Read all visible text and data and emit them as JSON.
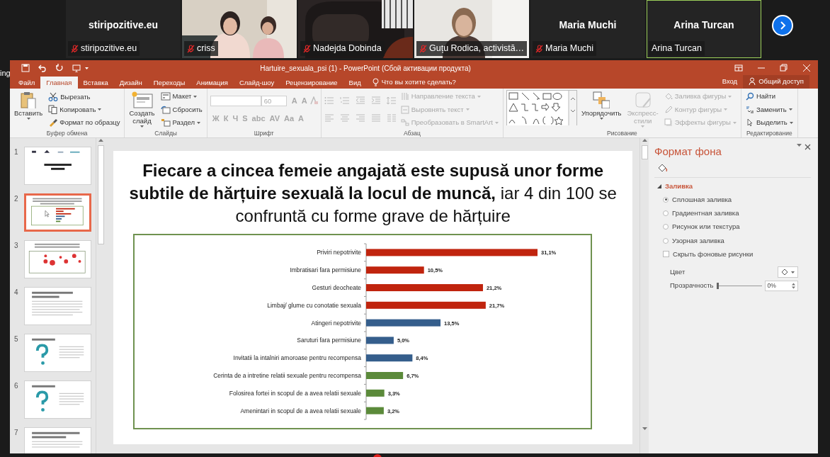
{
  "participants": [
    {
      "kind": "name",
      "name": "stiripozitive.eu",
      "label": "stiripozitive.eu",
      "muted": true,
      "speaking": false
    },
    {
      "kind": "video",
      "label": "criss",
      "muted": true,
      "speaking": false
    },
    {
      "kind": "video",
      "label": "Nadejda Dobinda",
      "muted": true,
      "speaking": false
    },
    {
      "kind": "video",
      "label": "Guțu Rodica, activistă…",
      "muted": true,
      "speaking": false
    },
    {
      "kind": "name",
      "name": "Maria Muchi",
      "label": "Maria Muchi",
      "muted": true,
      "speaking": false
    },
    {
      "kind": "name",
      "name": "Arina Turcan",
      "label": "Arina Turcan",
      "muted": false,
      "speaking": true
    }
  ],
  "behind_window_text": "ing",
  "window": {
    "title": "Hartuire_sexuala_psi (1) - PowerPoint (Сбой активации продукта)"
  },
  "tabs": [
    {
      "label": "Файл",
      "selected": false
    },
    {
      "label": "Главная",
      "selected": true
    },
    {
      "label": "Вставка",
      "selected": false
    },
    {
      "label": "Дизайн",
      "selected": false
    },
    {
      "label": "Переходы",
      "selected": false
    },
    {
      "label": "Анимация",
      "selected": false
    },
    {
      "label": "Слайд-шоу",
      "selected": false
    },
    {
      "label": "Рецензирование",
      "selected": false
    },
    {
      "label": "Вид",
      "selected": false
    }
  ],
  "tell_me": {
    "placeholder": "Что вы хотите сделать?"
  },
  "sign_in": "Вход",
  "share": "Общий доступ",
  "ribbon": {
    "groups": [
      {
        "kind": "commands",
        "label": "Буфер обмена",
        "large": [
          {
            "label": "Вставить",
            "disabled": false,
            "dropdown": true
          }
        ],
        "small": [
          {
            "label": "Вырезать",
            "disabled": false,
            "dropdown": false
          },
          {
            "label": "Копировать",
            "disabled": false,
            "dropdown": true
          },
          {
            "label": "Формат по образцу",
            "disabled": false,
            "dropdown": false
          }
        ]
      },
      {
        "kind": "commands",
        "label": "Слайды",
        "large": [
          {
            "label": "Создать\nслайд",
            "disabled": false,
            "dropdown": true
          }
        ],
        "small": [
          {
            "label": "Макет",
            "disabled": false,
            "dropdown": true
          },
          {
            "label": "Сбросить",
            "disabled": false,
            "dropdown": false
          },
          {
            "label": "Раздел",
            "disabled": false,
            "dropdown": true
          }
        ]
      },
      {
        "kind": "font",
        "label": "Шрифт",
        "size_value": "60",
        "row1": [
          {
            "label": "A",
            "disabled": true
          },
          {
            "label": "A",
            "disabled": true
          }
        ],
        "row2": [
          {
            "label": "Ж",
            "disabled": true
          },
          {
            "label": "К",
            "disabled": true
          },
          {
            "label": "Ч",
            "disabled": true
          },
          {
            "label": "S",
            "disabled": true
          },
          {
            "label": "abc",
            "disabled": true
          },
          {
            "label": "AV",
            "disabled": true
          },
          {
            "label": "Aa",
            "disabled": true
          },
          {
            "label": "A",
            "disabled": true
          }
        ]
      },
      {
        "kind": "paragraph",
        "label": "Абзац",
        "small": [
          {
            "label": "Направление текста",
            "disabled": true,
            "dropdown": true
          },
          {
            "label": "Выровнять текст",
            "disabled": true,
            "dropdown": true
          },
          {
            "label": "Преобразовать в SmartArt",
            "disabled": true,
            "dropdown": true
          }
        ]
      },
      {
        "kind": "drawing",
        "label": "Рисование",
        "large": [
          {
            "label": "Упорядочить",
            "disabled": false,
            "dropdown": true
          },
          {
            "label": "Экспресс-\nстили",
            "disabled": true,
            "dropdown": true
          }
        ],
        "small": [
          {
            "label": "Заливка фигуры",
            "disabled": true,
            "dropdown": true
          },
          {
            "label": "Контур фигуры",
            "disabled": true,
            "dropdown": true
          },
          {
            "label": "Эффекты фигуры",
            "disabled": true,
            "dropdown": true
          }
        ]
      },
      {
        "kind": "commands",
        "label": "Редактирование",
        "small": [
          {
            "label": "Найти",
            "disabled": false,
            "dropdown": false
          },
          {
            "label": "Заменить",
            "disabled": false,
            "dropdown": true
          },
          {
            "label": "Выделить",
            "disabled": false,
            "dropdown": true
          }
        ]
      }
    ]
  },
  "slides": [
    {
      "number": "1",
      "selected": false
    },
    {
      "number": "2",
      "selected": true
    },
    {
      "number": "3",
      "selected": false
    },
    {
      "number": "4",
      "selected": false
    },
    {
      "number": "5",
      "selected": false
    },
    {
      "number": "6",
      "selected": false
    },
    {
      "number": "7",
      "selected": false
    }
  ],
  "slide": {
    "title": "**Fiecare a cincea femeie angajată este supusă unor forme subtile de hărțuire sexuală la locul de muncă,** iar 4 din 100 se confruntă cu forme grave de hărțuire",
    "chart_data": {
      "type": "bar",
      "orientation": "horizontal",
      "categories": [
        "Priviri nepotrivite",
        "Imbratisari fara permisiune",
        "Gesturi deocheate",
        "Limbaj/ glume cu conotatie sexuala",
        "Atingeri nepotrivite",
        "Saruturi fara permisiune",
        "Invitatii la intalniri amoroase pentru recompensa",
        "Cerinta de a intretine relatii sexuale pentru recompensa",
        "Folosirea fortei in scopul de a avea relatii sexuale",
        "Amenintari in scopul de a avea relatii sexuale"
      ],
      "series": [
        {
          "color": "#c0240e",
          "values": [
            31.1,
            10.5,
            21.2,
            21.7,
            null,
            null,
            null,
            null,
            null,
            null
          ],
          "value_labels": [
            "31,1%",
            "10,5%",
            "21,2%",
            "21,7%",
            null,
            null,
            null,
            null,
            null,
            null
          ]
        },
        {
          "color": "#355e8c",
          "values": [
            null,
            null,
            null,
            null,
            13.5,
            5.0,
            8.4,
            null,
            null,
            null
          ],
          "value_labels": [
            null,
            null,
            null,
            null,
            "13,5%",
            "5,0%",
            "8,4%",
            null,
            null,
            null
          ]
        },
        {
          "color": "#5b8a3a",
          "values": [
            null,
            null,
            null,
            null,
            null,
            null,
            null,
            6.7,
            3.3,
            3.2
          ],
          "value_labels": [
            null,
            null,
            null,
            null,
            null,
            null,
            null,
            "6,7%",
            "3,3%",
            "3,2%"
          ]
        }
      ]
    }
  },
  "format_pane": {
    "title": "Формат фона",
    "section": {
      "label": "Заливка",
      "expanded": true
    },
    "fill_options": [
      {
        "label": "Сплошная заливка",
        "selected": true
      },
      {
        "label": "Градиентная заливка",
        "selected": false
      },
      {
        "label": "Рисунок или текстура",
        "selected": false
      },
      {
        "label": "Узорная заливка",
        "selected": false
      }
    ],
    "hide_background": {
      "label": "Скрыть фоновые рисунки",
      "checked": false
    },
    "color": {
      "label": "Цвет"
    },
    "transparency": {
      "label": "Прозрачность",
      "level": 0,
      "value": "0%"
    }
  }
}
